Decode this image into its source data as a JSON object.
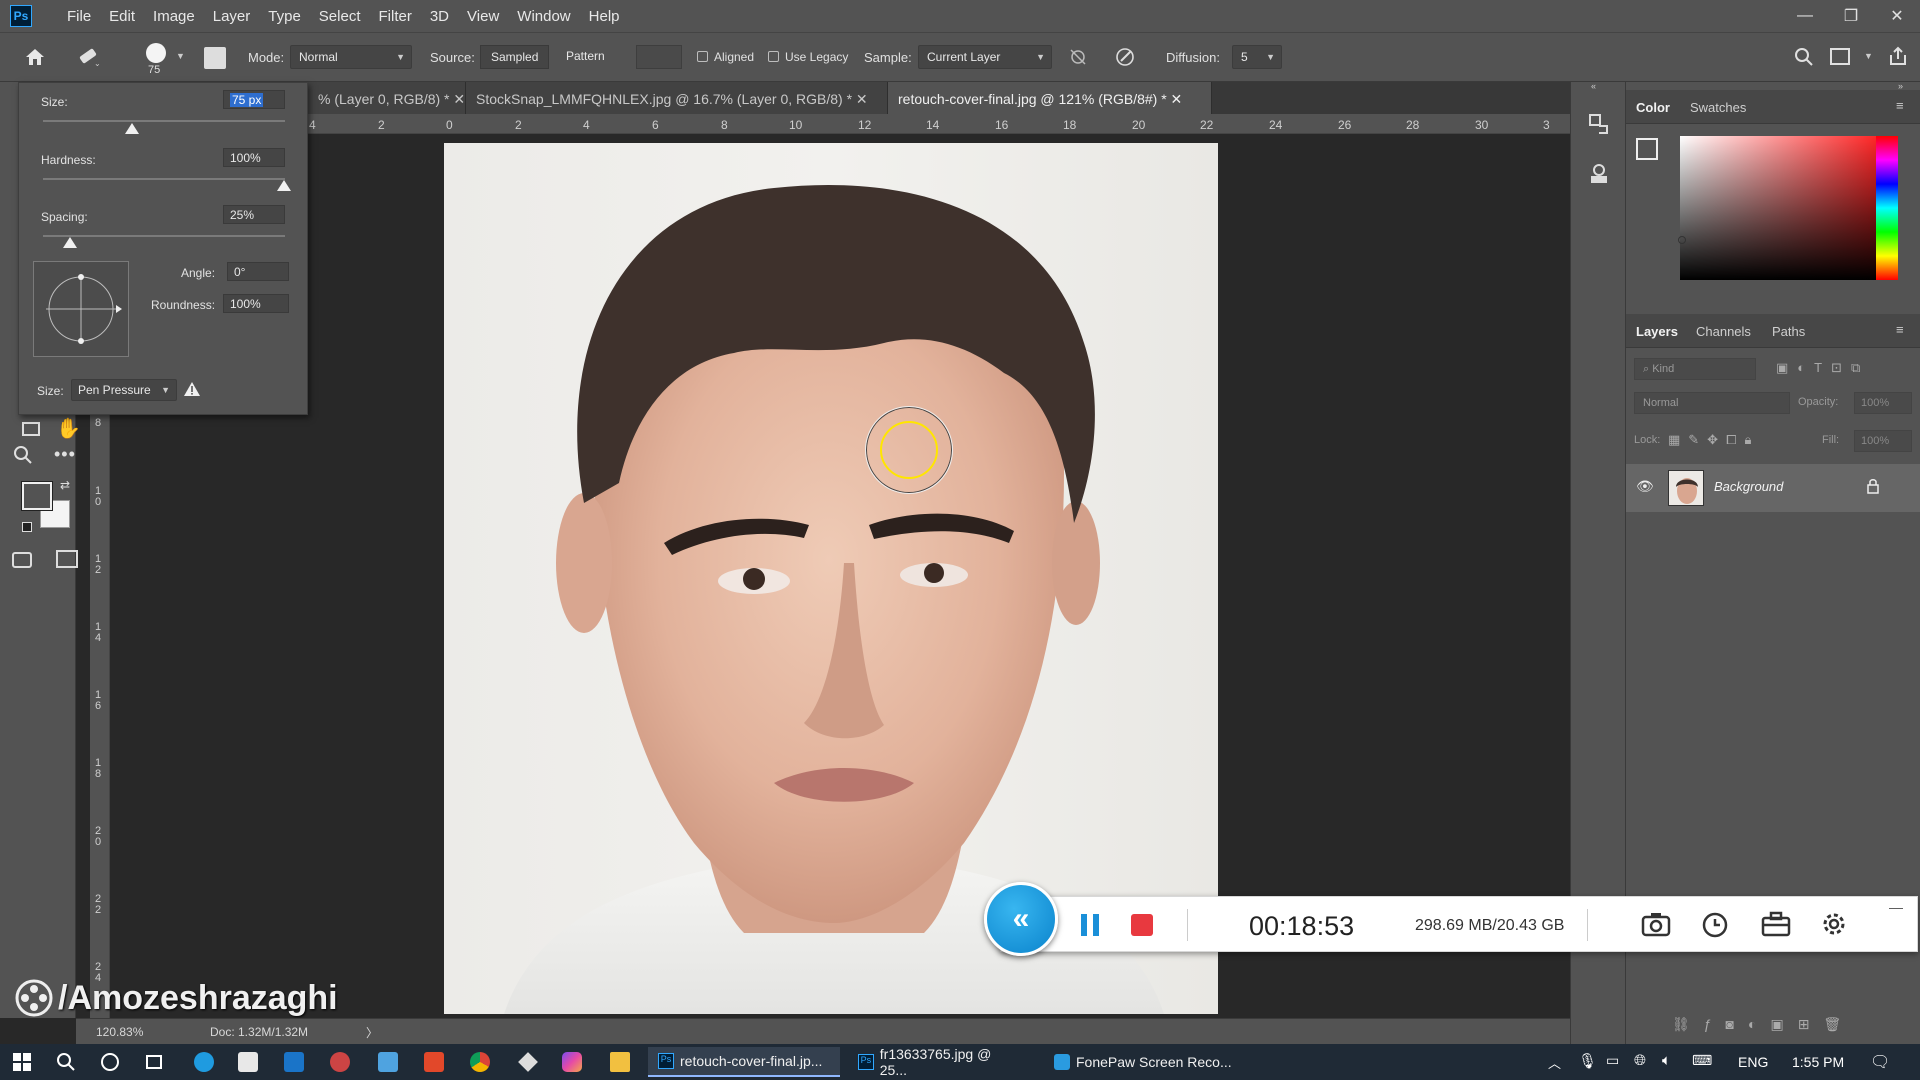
{
  "app": {
    "logo": "Ps",
    "menus": [
      "File",
      "Edit",
      "Image",
      "Layer",
      "Type",
      "Select",
      "Filter",
      "3D",
      "View",
      "Window",
      "Help"
    ],
    "window_controls": {
      "minimize": "—",
      "restore": "❐",
      "close": "✕"
    }
  },
  "options": {
    "brush_size": "75",
    "mode_label": "Mode:",
    "mode_value": "Normal",
    "source_label": "Source:",
    "source_sampled": "Sampled",
    "source_pattern": "Pattern",
    "aligned_label": "Aligned",
    "legacy_label": "Use Legacy",
    "sample_label": "Sample:",
    "sample_value": "Current Layer",
    "diffusion_label": "Diffusion:",
    "diffusion_value": "5"
  },
  "brush_popup": {
    "size_label": "Size:",
    "size_value": "75 px",
    "hardness_label": "Hardness:",
    "hardness_value": "100%",
    "spacing_label": "Spacing:",
    "spacing_value": "25%",
    "angle_label": "Angle:",
    "angle_value": "0°",
    "roundness_label": "Roundness:",
    "roundness_value": "100%",
    "size_control_label": "Size:",
    "size_control_value": "Pen Pressure"
  },
  "tabs": [
    {
      "label": "% (Layer 0, RGB/8) * ✕",
      "active": false
    },
    {
      "label": "StockSnap_LMMFQHNLEX.jpg @ 16.7% (Layer 0, RGB/8) * ✕",
      "active": false
    },
    {
      "label": "retouch-cover-final.jpg @ 121% (RGB/8#) * ✕",
      "active": true
    }
  ],
  "ruler_top_labels": [
    "4",
    "2",
    "0",
    "2",
    "4",
    "6",
    "8",
    "10",
    "12",
    "14",
    "16",
    "18",
    "20",
    "22",
    "24",
    "26",
    "28",
    "30",
    "3"
  ],
  "ruler_left_labels": [
    "8",
    "1 0",
    "1 2",
    "1 4",
    "1 6",
    "1 8",
    "2 0",
    "2 2",
    "2 4"
  ],
  "status": {
    "zoom": "120.83%",
    "doc": "Doc: 1.32M/1.32M",
    "arrow": "〉"
  },
  "watermark": "/Amozeshrazaghi",
  "color_panel": {
    "tabs": [
      "Color",
      "Swatches"
    ]
  },
  "layers_panel": {
    "tabs": [
      "Layers",
      "Channels",
      "Paths"
    ],
    "kind_placeholder": "Kind",
    "blend_mode": "Normal",
    "opacity_label": "Opacity:",
    "opacity_value": "100%",
    "lock_label": "Lock:",
    "fill_label": "Fill:",
    "fill_value": "100%",
    "layer_name": "Background"
  },
  "recorder": {
    "timer": "00:18:53",
    "storage": "298.69 MB/20.43 GB",
    "minimize": "—"
  },
  "taskbar": {
    "apps": [
      {
        "label": "retouch-cover-final.jp...",
        "active": true
      },
      {
        "label": "fr13633765.jpg @ 25...",
        "active": false
      },
      {
        "label": "FonePaw Screen Reco...",
        "active": false
      }
    ],
    "lang": "ENG",
    "time": "1:55 PM"
  }
}
